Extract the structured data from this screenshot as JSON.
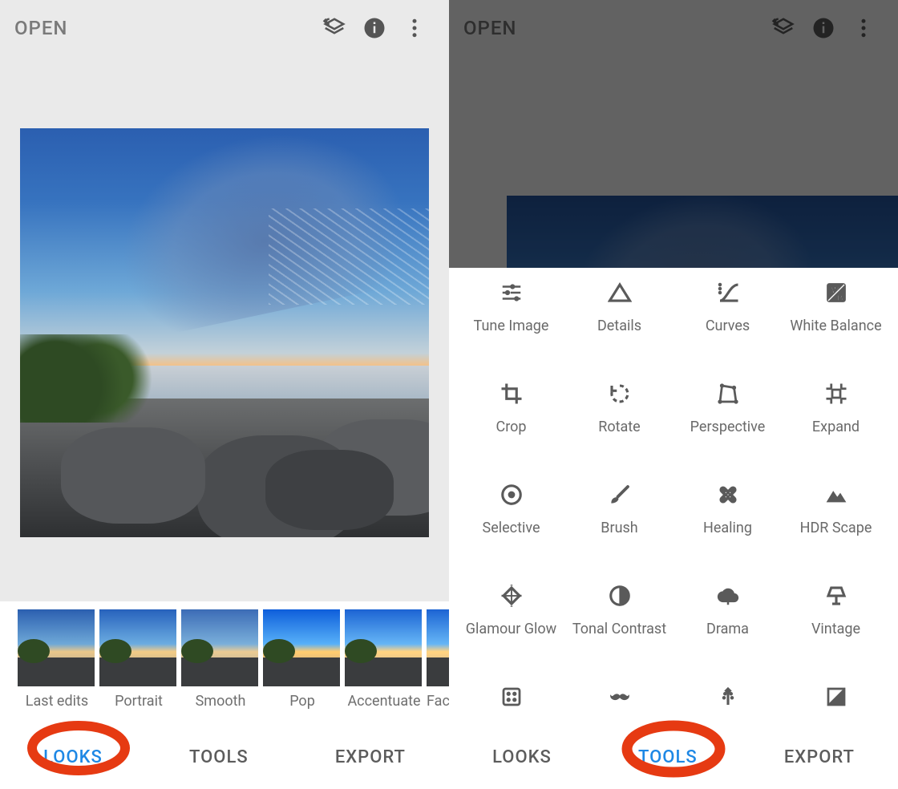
{
  "left": {
    "open_label": "OPEN",
    "looks": [
      {
        "label": "Last edits"
      },
      {
        "label": "Portrait"
      },
      {
        "label": "Smooth"
      },
      {
        "label": "Pop"
      },
      {
        "label": "Accentuate"
      },
      {
        "label": "Fac"
      }
    ],
    "tabs": {
      "looks": "LOOKS",
      "tools": "TOOLS",
      "export": "EXPORT"
    },
    "active_tab": "looks"
  },
  "right": {
    "open_label": "OPEN",
    "tools": [
      {
        "label": "Tune Image",
        "icon": "sliders"
      },
      {
        "label": "Details",
        "icon": "triangle"
      },
      {
        "label": "Curves",
        "icon": "curves"
      },
      {
        "label": "White Balance",
        "icon": "wb"
      },
      {
        "label": "Crop",
        "icon": "crop"
      },
      {
        "label": "Rotate",
        "icon": "rotate"
      },
      {
        "label": "Perspective",
        "icon": "perspective"
      },
      {
        "label": "Expand",
        "icon": "expand"
      },
      {
        "label": "Selective",
        "icon": "target"
      },
      {
        "label": "Brush",
        "icon": "brush"
      },
      {
        "label": "Healing",
        "icon": "bandage"
      },
      {
        "label": "HDR Scape",
        "icon": "mountains"
      },
      {
        "label": "Glamour Glow",
        "icon": "diamond"
      },
      {
        "label": "Tonal Contrast",
        "icon": "tonal"
      },
      {
        "label": "Drama",
        "icon": "cloud"
      },
      {
        "label": "Vintage",
        "icon": "lamp"
      },
      {
        "label": "",
        "icon": "dice"
      },
      {
        "label": "",
        "icon": "moustache"
      },
      {
        "label": "",
        "icon": "guitar"
      },
      {
        "label": "",
        "icon": "bw"
      }
    ],
    "tabs": {
      "looks": "LOOKS",
      "tools": "TOOLS",
      "export": "EXPORT"
    },
    "active_tab": "tools"
  },
  "annotation_color": "#e63a12"
}
